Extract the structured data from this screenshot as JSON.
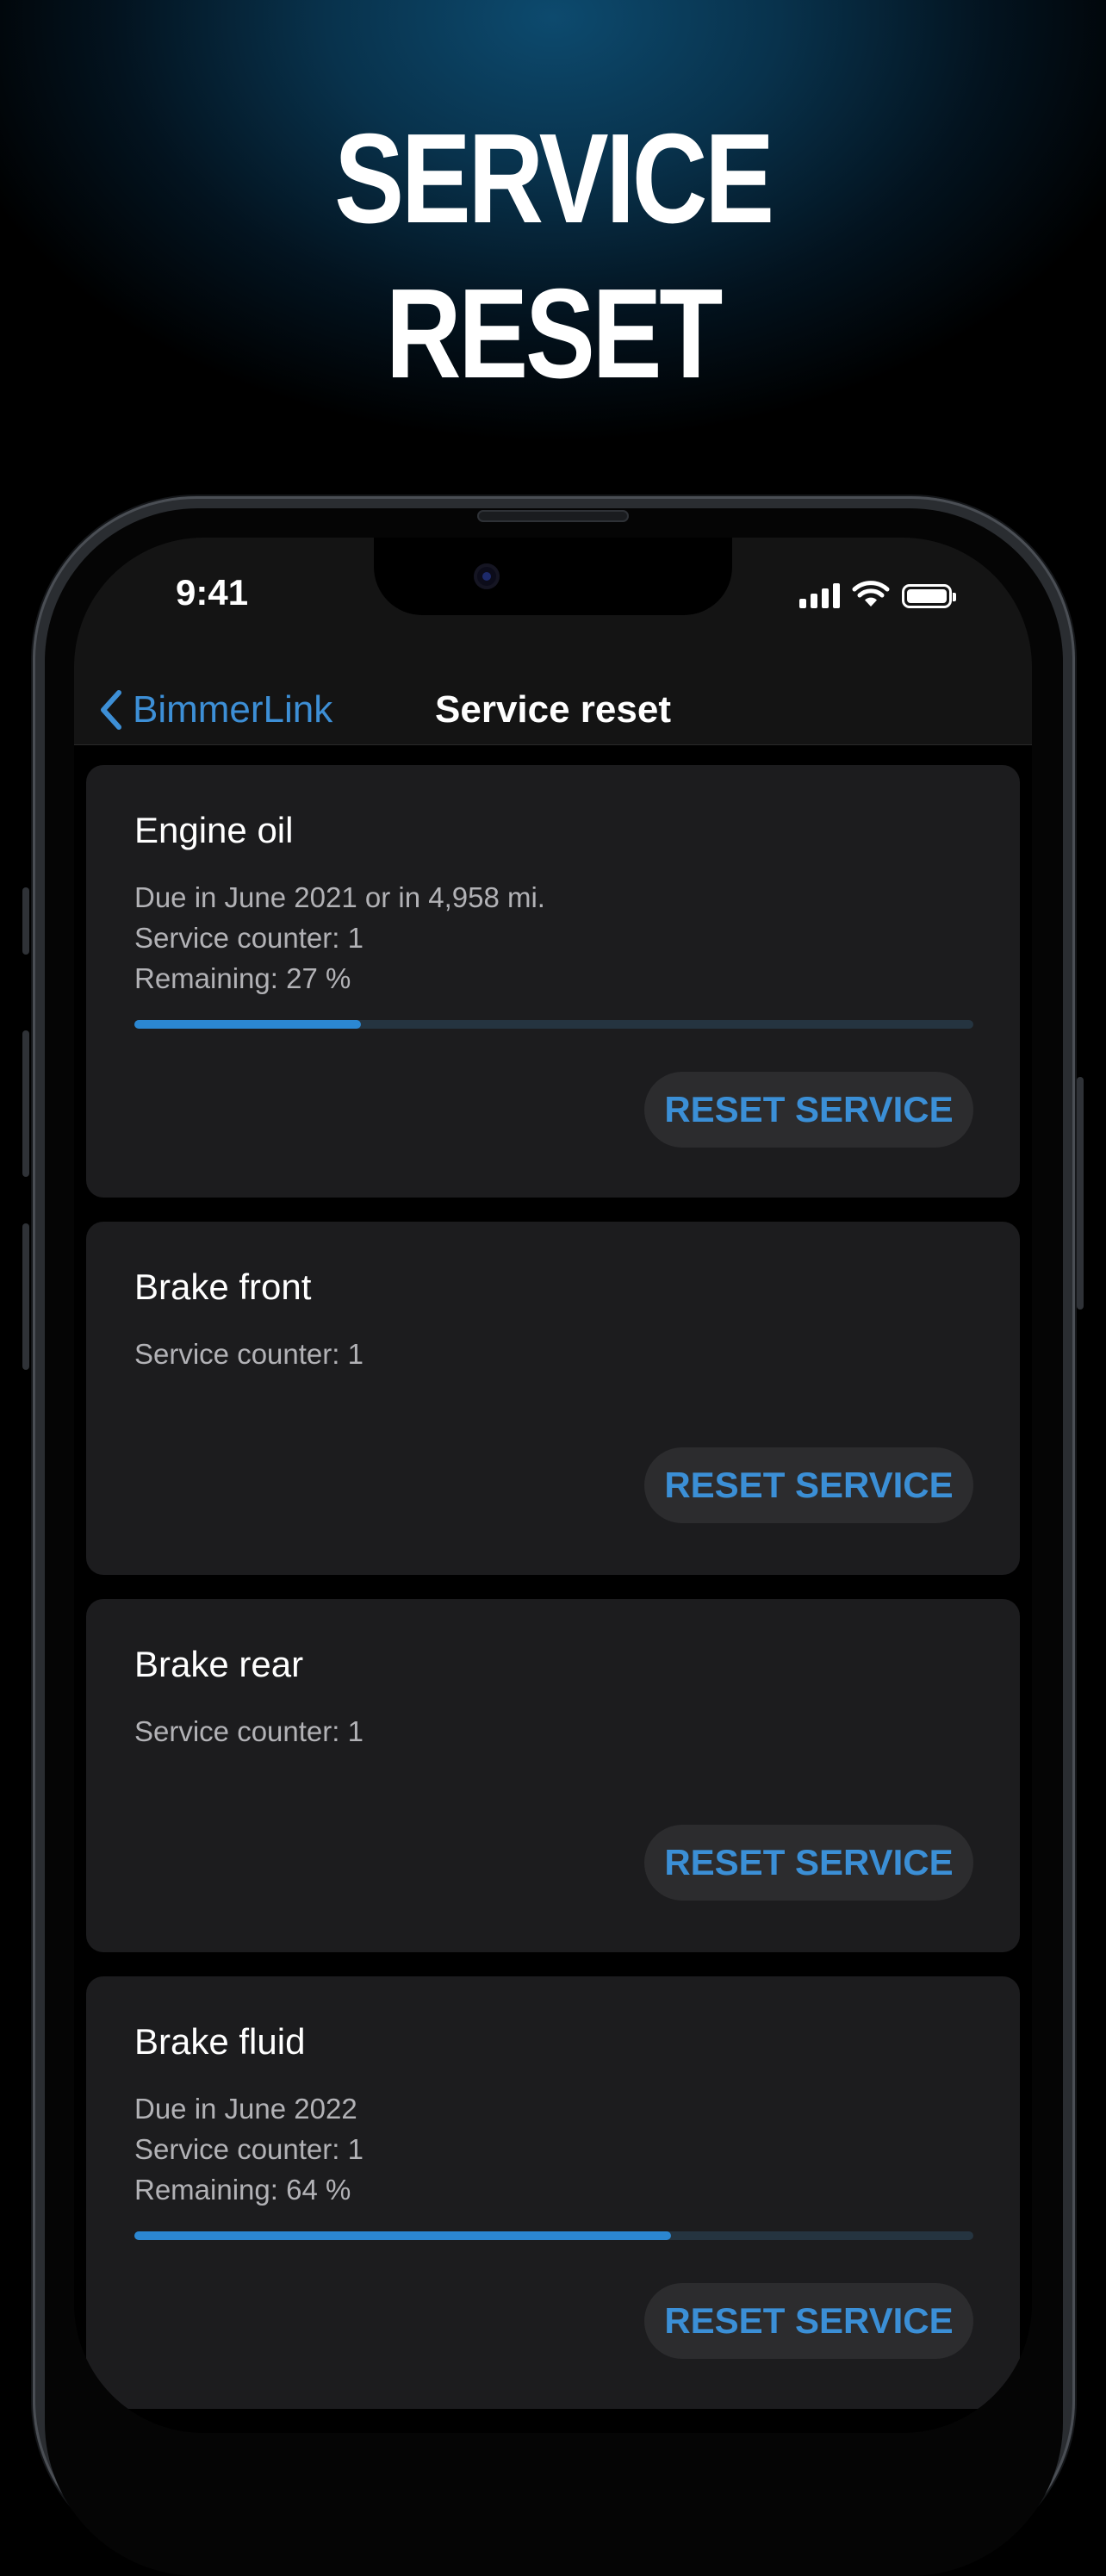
{
  "headline": {
    "line1": "SERVICE",
    "line2": "RESET"
  },
  "status_bar": {
    "time": "9:41",
    "icons": [
      "signal-icon",
      "wifi-icon",
      "battery-icon"
    ]
  },
  "nav": {
    "back_label": "BimmerLink",
    "title": "Service reset"
  },
  "colors": {
    "accent": "#3b8fd6",
    "card": "#1c1c1e",
    "background": "#000000",
    "progress_track": "#253440"
  },
  "services": [
    {
      "name": "Engine oil",
      "lines": [
        "Due in June 2021 or in 4,958 mi.",
        "Service counter: 1",
        "Remaining: 27 %"
      ],
      "remaining_fraction": 0.27,
      "button": "RESET SERVICE"
    },
    {
      "name": "Brake front",
      "lines": [
        "Service counter: 1"
      ],
      "button": "RESET SERVICE"
    },
    {
      "name": "Brake rear",
      "lines": [
        "Service counter: 1"
      ],
      "button": "RESET SERVICE"
    },
    {
      "name": "Brake fluid",
      "lines": [
        "Due in June 2022",
        "Service counter: 1",
        "Remaining: 64 %"
      ],
      "remaining_fraction": 0.64,
      "button": "RESET SERVICE"
    }
  ]
}
